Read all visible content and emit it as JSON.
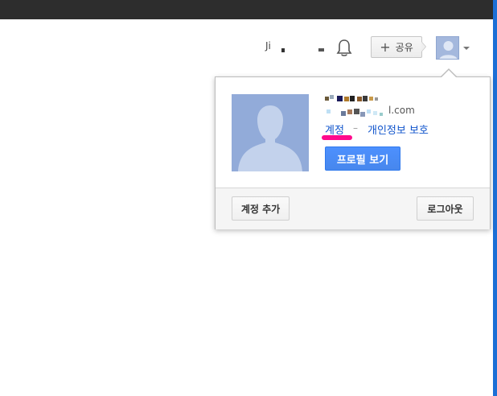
{
  "header": {
    "user_name_short": "Ji",
    "share_plus": "+",
    "share_label": "공유"
  },
  "popup": {
    "email_suffix": "l.com",
    "account_link": "계정",
    "separator": "–",
    "privacy_link": "개인정보 보호",
    "view_profile_label": "프로필 보기",
    "add_account_label": "계정 추가",
    "logout_label": "로그아웃"
  },
  "colors": {
    "link": "#1155cc",
    "primary_button": "#4d90fe",
    "annotation": "#ff0a8c",
    "topbar": "#2d2d2d"
  },
  "icons": {
    "notification": "bell-icon",
    "avatar": "person-silhouette",
    "menu_caret": "chevron-down-icon"
  }
}
